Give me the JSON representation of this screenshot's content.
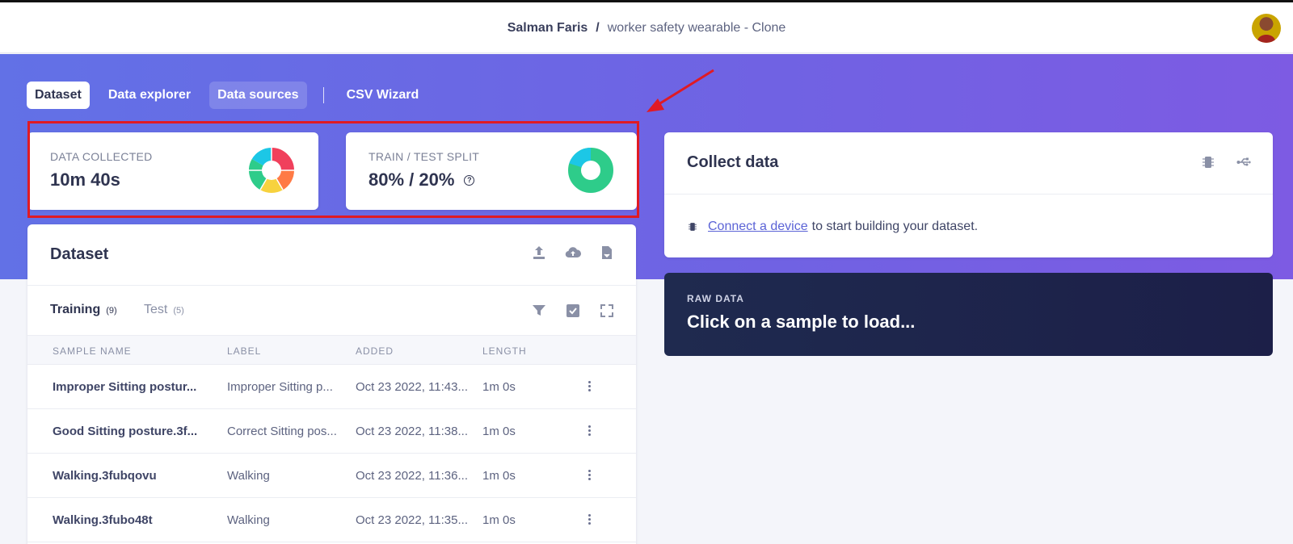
{
  "header": {
    "user": "Salman Faris",
    "separator": "/",
    "project": "worker safety wearable - Clone"
  },
  "nav_tabs": [
    {
      "label": "Dataset",
      "active": true
    },
    {
      "label": "Data explorer",
      "active": false
    },
    {
      "label": "Data sources",
      "active": false
    },
    {
      "label": "CSV Wizard",
      "active": false
    }
  ],
  "stats": {
    "data_collected": {
      "label": "DATA COLLECTED",
      "value": "10m 40s"
    },
    "train_test_split": {
      "label": "TRAIN / TEST SPLIT",
      "value": "80% / 20%",
      "help_icon": "?"
    }
  },
  "dataset": {
    "title": "Dataset",
    "header_icons": [
      "upload-icon",
      "cloud-upload-icon",
      "export-file-icon"
    ],
    "tabs": [
      {
        "label": "Training",
        "count": "(9)",
        "active": true
      },
      {
        "label": "Test",
        "count": "(5)",
        "active": false
      }
    ],
    "tool_icons": [
      "filter-icon",
      "select-checkbox-icon",
      "expand-icon"
    ],
    "columns": [
      "SAMPLE NAME",
      "LABEL",
      "ADDED",
      "LENGTH"
    ],
    "rows": [
      {
        "name": "Improper Sitting postur...",
        "label": "Improper Sitting p...",
        "added": "Oct 23 2022, 11:43...",
        "length": "1m 0s"
      },
      {
        "name": "Good Sitting posture.3f...",
        "label": "Correct Sitting pos...",
        "added": "Oct 23 2022, 11:38...",
        "length": "1m 0s"
      },
      {
        "name": "Walking.3fubqovu",
        "label": "Walking",
        "added": "Oct 23 2022, 11:36...",
        "length": "1m 0s"
      },
      {
        "name": "Walking.3fubo48t",
        "label": "Walking",
        "added": "Oct 23 2022, 11:35...",
        "length": "1m 0s"
      }
    ]
  },
  "collect": {
    "title": "Collect data",
    "header_icons": [
      "chip-icon",
      "usb-icon"
    ],
    "link": "Connect a device",
    "text": "to start building your dataset."
  },
  "raw_data": {
    "label": "RAW DATA",
    "message": "Click on a sample to load..."
  },
  "colors": {
    "hero_start": "#6271e6",
    "hero_end": "#7d5be3",
    "highlight": "#e01a24",
    "raw_bg": "#1c1f48",
    "donut_green": "#2ecc8a",
    "donut_cyan": "#1cc7e6",
    "donut_red": "#f0405c",
    "donut_orange": "#ff7a45",
    "donut_yellow": "#f7d23e"
  }
}
